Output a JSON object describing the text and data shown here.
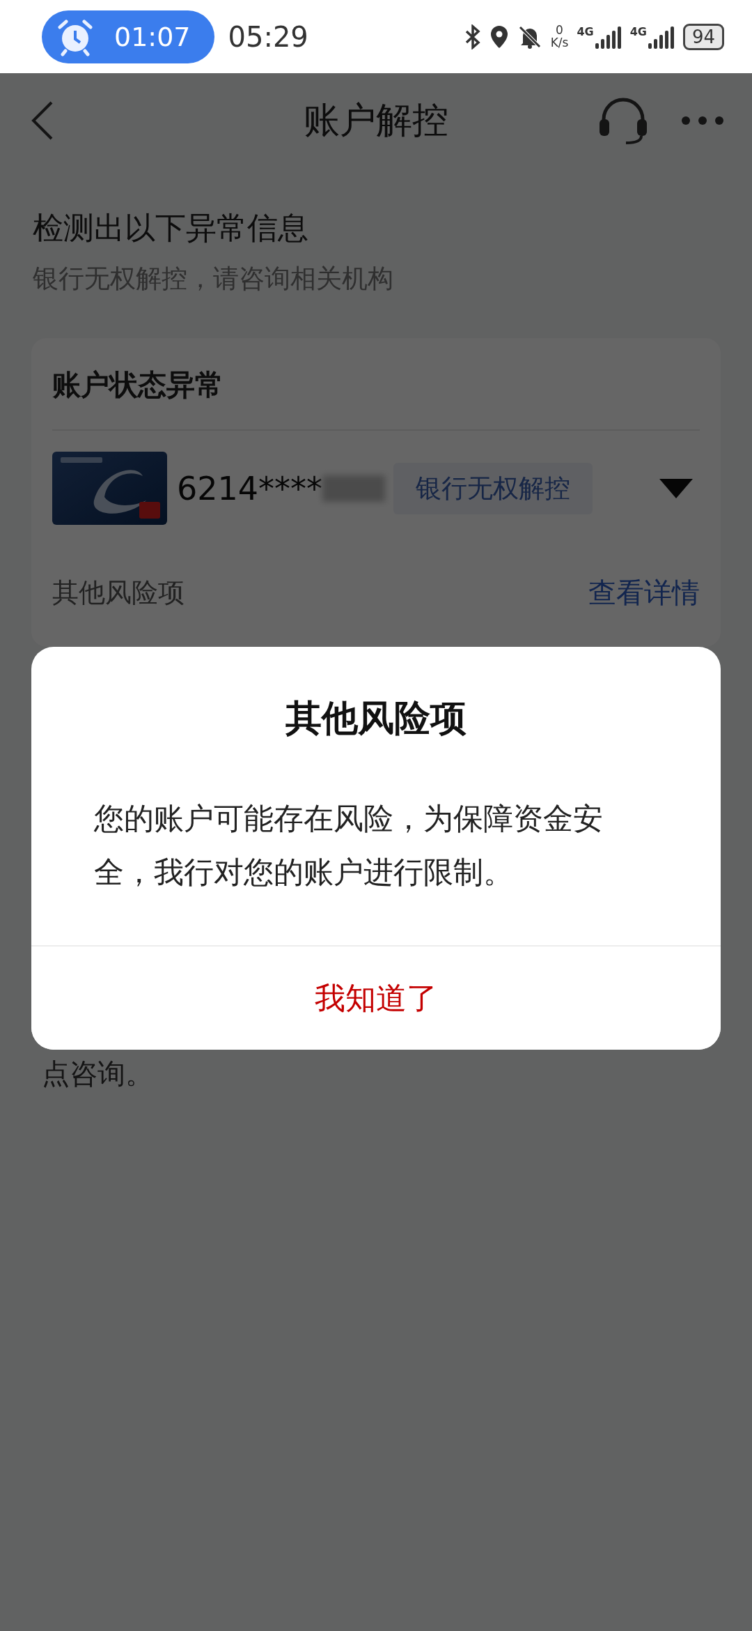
{
  "status_bar": {
    "alarm_time": "01:07",
    "time": "05:29",
    "net_speed_value": "0",
    "net_speed_unit": "K/s",
    "sim_labels": [
      "4G",
      "4G"
    ],
    "battery": "94"
  },
  "nav": {
    "title": "账户解控"
  },
  "notice": {
    "heading": "检测出以下异常信息",
    "subheading": "银行无权解控，请咨询相关机构"
  },
  "card": {
    "title": "账户状态异常",
    "account": {
      "number": "6214****",
      "tag": "银行无权解控",
      "expanded": false
    },
    "risk_row": {
      "label": "其他风险项",
      "link": "查看详情"
    }
  },
  "footer_text": "点咨询。",
  "dialog": {
    "title": "其他风险项",
    "message": "您的账户可能存在风险，为保障资金安全，我行对您的账户进行限制。",
    "button": "我知道了"
  }
}
